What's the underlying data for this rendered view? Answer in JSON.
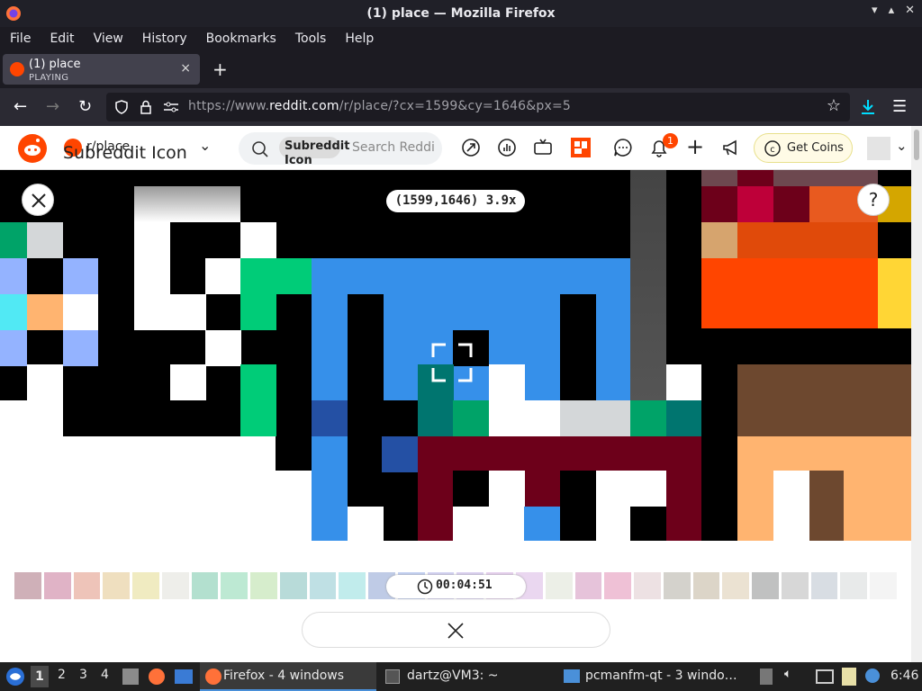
{
  "window": {
    "title": "(1) place — Mozilla Firefox"
  },
  "menu": [
    {
      "label": "File"
    },
    {
      "label": "Edit"
    },
    {
      "label": "View"
    },
    {
      "label": "History"
    },
    {
      "label": "Bookmarks"
    },
    {
      "label": "Tools"
    },
    {
      "label": "Help"
    }
  ],
  "tab": {
    "title": "(1) place",
    "status": "PLAYING",
    "close": "×"
  },
  "newtab": "+",
  "url": {
    "prefix": "https://www.",
    "domain": "reddit.com",
    "path": "/r/place/?cx=1599&cy=1646&px=5"
  },
  "reddit": {
    "subreddit": "r/place",
    "subreddit_icon_alt": "Subreddit Icon",
    "search_chip_label": "Subreddit Icon",
    "search_placeholder": "Search Reddi",
    "notification_count": "1",
    "coins_label": "Get Coins"
  },
  "place": {
    "coords": "(1599,1646) 3.9x",
    "timer": "00:04:51"
  },
  "taskbar": {
    "workspaces": [
      "1",
      "2",
      "3",
      "4"
    ],
    "firefox": "Firefox - 4 windows",
    "terminal": "dartz@VM3: ~",
    "filemanager": "pcmanfm-qt - 3 windo…",
    "clock": "6:46"
  },
  "colors": {
    "accent": "#ff4500",
    "firefox_chrome": "#2b2a33"
  },
  "palette": [
    "#cfb0b8",
    "#e0b3c6",
    "#eec4b9",
    "#efdfbf",
    "#f0ebc1",
    "#eeeeea",
    "#b3e0cf",
    "#bde9d3",
    "#d6edcc",
    "#b8dbd9",
    "#bfe0e4",
    "#c1ecec",
    "#bfcbe6",
    "#c3d1f2",
    "#d3d2f2",
    "#dad1f1",
    "#e6d1ee",
    "#ead7f0",
    "#ecefe7",
    "#e6c3da",
    "#efc1d6",
    "#ede1e3",
    "#d4d2cc",
    "#dcd5c8",
    "#ebe2d2",
    "#c0c1c1",
    "#d7d7d7",
    "#d8dde3",
    "#e8eaea",
    "#f4f4f4"
  ]
}
